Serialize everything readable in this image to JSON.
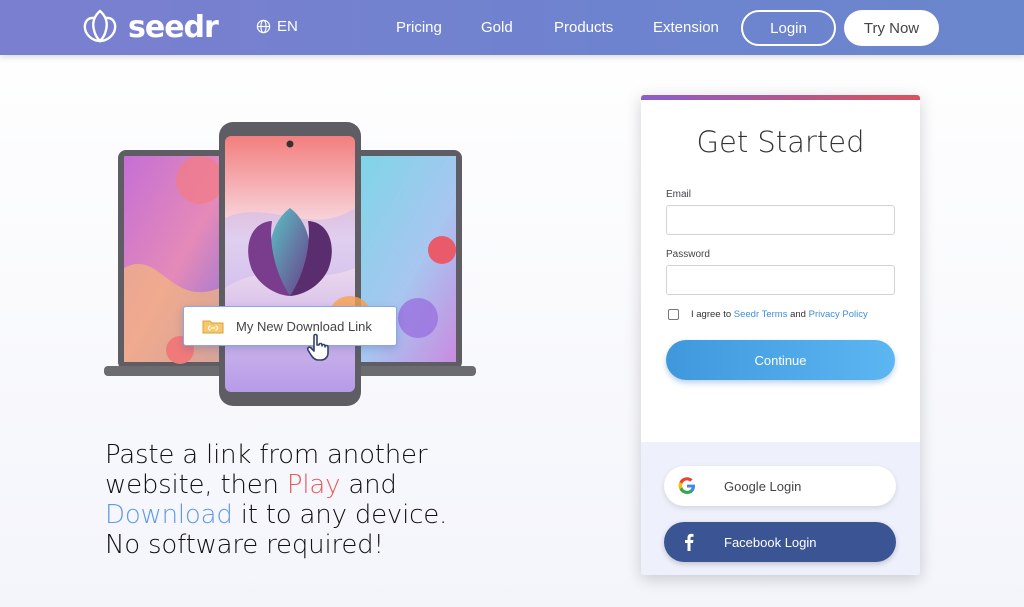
{
  "nav": {
    "brand": "seedr",
    "language": "EN",
    "links": [
      "Pricing",
      "Gold",
      "Products",
      "Extension"
    ],
    "login_label": "Login",
    "try_label": "Try Now"
  },
  "hero": {
    "link_tag": "My New Download Link",
    "line1": "Paste a link from another",
    "line2_a": "website, then ",
    "line2_play": "Play",
    "line2_b": " and",
    "line3_dl": "Download",
    "line3_b": " it to any device.",
    "line4": "No software required!"
  },
  "signup": {
    "title": "Get Started",
    "email_label": "Email",
    "email_value": "",
    "password_label": "Password",
    "password_value": "",
    "agree_prefix": "I agree to ",
    "terms_link": "Seedr Terms",
    "agree_and": " and ",
    "privacy_link": "Privacy Policy",
    "continue_label": "Continue",
    "google_label": "Google Login",
    "facebook_label": "Facebook Login"
  },
  "colors": {
    "nav_bg": "#7180cf",
    "accent_play": "#e45b5b",
    "accent_download": "#5b9be8",
    "continue_bg": "#4ba7e8",
    "facebook_bg": "#3b5594"
  },
  "icons": {
    "logo": "tulip-icon",
    "language": "globe-icon",
    "tag": "folder-link-icon",
    "cursor": "hand-pointer-icon",
    "google": "google-icon",
    "facebook": "facebook-icon"
  }
}
